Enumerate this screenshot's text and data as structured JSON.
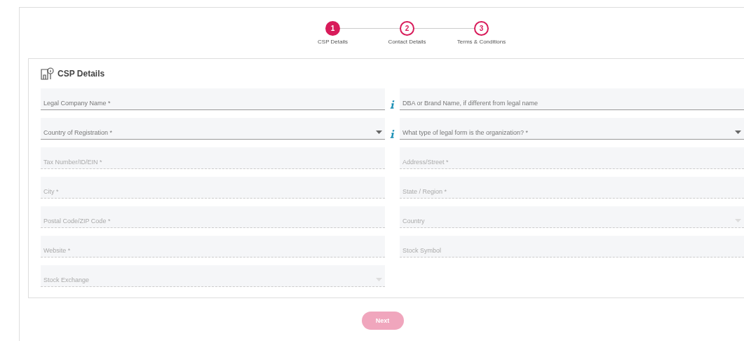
{
  "steps": [
    {
      "number": "1",
      "label": "CSP Details",
      "selected": true
    },
    {
      "number": "2",
      "label": "Contact Details",
      "selected": false
    },
    {
      "number": "3",
      "label": "Terms & Conditions",
      "selected": false
    }
  ],
  "section": {
    "title": "CSP Details"
  },
  "fields": [
    {
      "kind": "text",
      "placeholder": "Legal Company Name *",
      "disabled": false,
      "info": true
    },
    {
      "kind": "text",
      "placeholder": "DBA or Brand Name, if different from legal name",
      "disabled": false,
      "info": false
    },
    {
      "kind": "select",
      "placeholder": "Country of Registration *",
      "disabled": false,
      "info": true
    },
    {
      "kind": "select",
      "placeholder": "What type of legal form is the organization? *",
      "disabled": false,
      "info": false
    },
    {
      "kind": "text",
      "placeholder": "Tax Number/ID/EIN *",
      "disabled": true,
      "info": false
    },
    {
      "kind": "text",
      "placeholder": "Address/Street *",
      "disabled": true,
      "info": false
    },
    {
      "kind": "text",
      "placeholder": "City *",
      "disabled": true,
      "info": false
    },
    {
      "kind": "text",
      "placeholder": "State / Region *",
      "disabled": true,
      "info": false
    },
    {
      "kind": "text",
      "placeholder": "Postal Code/ZIP Code *",
      "disabled": true,
      "info": false
    },
    {
      "kind": "select",
      "placeholder": "Country",
      "disabled": true,
      "info": false
    },
    {
      "kind": "text",
      "placeholder": "Website *",
      "disabled": true,
      "info": false
    },
    {
      "kind": "text",
      "placeholder": "Stock Symbol",
      "disabled": true,
      "info": false
    },
    {
      "kind": "select",
      "placeholder": "Stock Exchange",
      "disabled": true,
      "info": false
    }
  ],
  "next_button": {
    "label": "Next",
    "disabled": true
  }
}
